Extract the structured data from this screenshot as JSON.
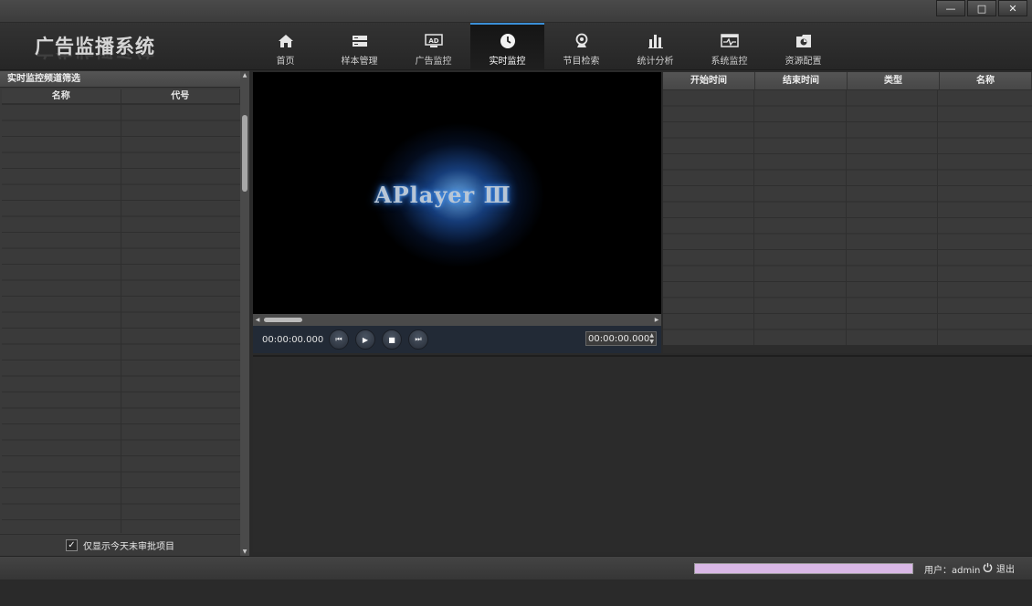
{
  "window": {
    "minimize": "—",
    "maximize": "□",
    "close": "✕"
  },
  "app": {
    "title": "广告监播系统"
  },
  "nav": {
    "items": [
      {
        "label": "首页",
        "icon": "home-icon"
      },
      {
        "label": "样本管理",
        "icon": "sample-manage-icon"
      },
      {
        "label": "广告监控",
        "icon": "ad-monitor-icon"
      },
      {
        "label": "实时监控",
        "icon": "clock-icon",
        "active": true
      },
      {
        "label": "节目检索",
        "icon": "search-camera-icon"
      },
      {
        "label": "统计分析",
        "icon": "bar-chart-icon"
      },
      {
        "label": "系统监控",
        "icon": "system-monitor-icon"
      },
      {
        "label": "资源配置",
        "icon": "resource-config-icon"
      }
    ]
  },
  "left": {
    "title": "实时监控频道筛选",
    "columns": [
      "名称",
      "代号"
    ],
    "filter_label": "仅显示今天未审批项目",
    "filter_checked": true
  },
  "player": {
    "logo": "APlayer Ⅲ",
    "current_time": "00:00:00.000",
    "seek_time": "00:00:00.000",
    "accent": "#3b8fd6"
  },
  "right": {
    "columns": [
      "开始时间",
      "结束时间",
      "类型",
      "名称"
    ]
  },
  "status": {
    "user": "用户：admin",
    "logout": "退出",
    "progress_color": "#d9b8e6"
  }
}
